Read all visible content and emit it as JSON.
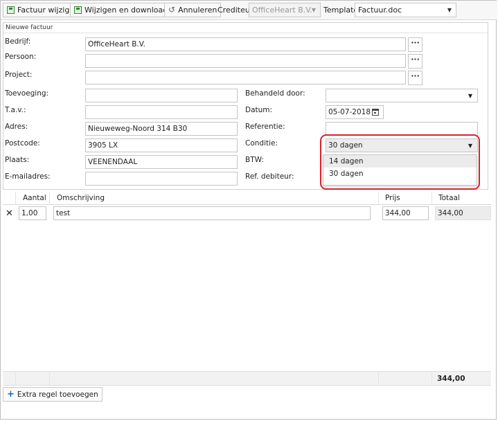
{
  "toolbar": {
    "save_label": "Factuur wijzigen",
    "save_download_label": "Wijzigen en downloaden",
    "cancel_label": "Annuleren",
    "crediteur_label": "Crediteur",
    "crediteur_value": "OfficeHeart B.V.",
    "template_label": "Template",
    "template_value": "Factuur.doc"
  },
  "panel": {
    "title": "Nieuwe factuur",
    "bedrijf_label": "Bedrijf:",
    "bedrijf_value": "OfficeHeart B.V.",
    "persoon_label": "Persoon:",
    "persoon_value": "",
    "project_label": "Project:",
    "project_value": "",
    "toevoeging_label": "Toevoeging:",
    "toevoeging_value": "",
    "tav_label": "T.a.v.:",
    "tav_value": "",
    "adres_label": "Adres:",
    "adres_value": "Nieuweweg-Noord 314 B30",
    "postcode_label": "Postcode:",
    "postcode_value": "3905 LX",
    "plaats_label": "Plaats:",
    "plaats_value": "VEENENDAAL",
    "email_label": "E-mailadres:",
    "email_value": "",
    "behandeld_label": "Behandeld door:",
    "behandeld_value": "",
    "datum_label": "Datum:",
    "datum_value": "05-07-2018",
    "referentie_label": "Referentie:",
    "referentie_value": "",
    "conditie_label": "Conditie:",
    "conditie_value": "30 dagen",
    "conditie_options": [
      "14 dagen",
      "30 dagen"
    ],
    "btw_label": "BTW:",
    "refdeb_label": "Ref. debiteur:"
  },
  "lines": {
    "headers": {
      "aantal": "Aantal",
      "omschrijving": "Omschrijving",
      "prijs": "Prijs",
      "totaal": "Totaal"
    },
    "rows": [
      {
        "aantal": "1,00",
        "omschrijving": "test",
        "prijs": "344,00",
        "totaal": "344,00"
      }
    ],
    "grand_total": "344,00",
    "add_label": "Extra regel toevoegen"
  },
  "colors": {
    "highlight": "#d9222a",
    "accent_blue": "#1a66b8",
    "save_green": "#2d8a2d"
  }
}
